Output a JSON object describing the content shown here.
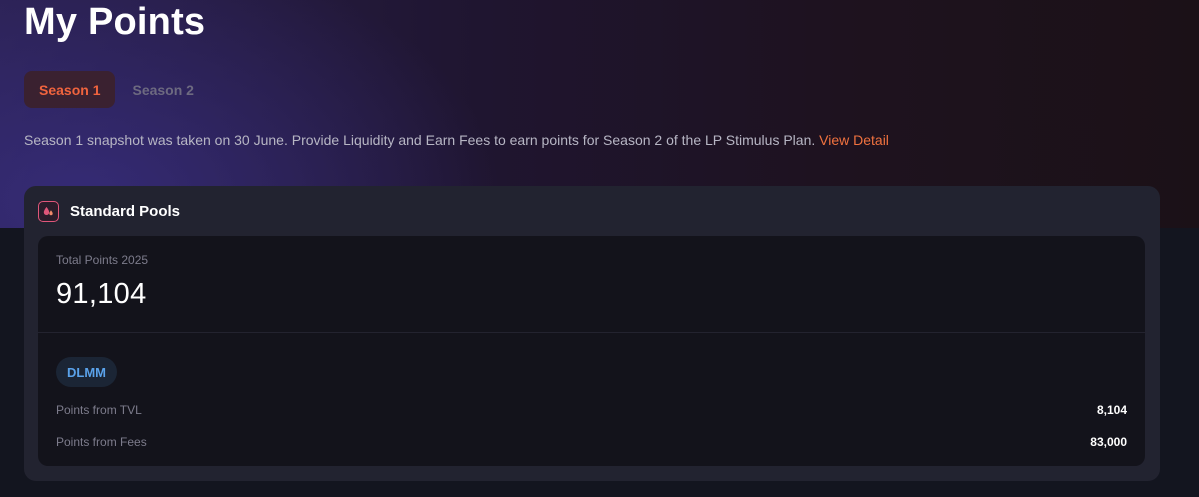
{
  "page": {
    "title": "My Points"
  },
  "tabs": [
    {
      "label": "Season 1",
      "active": true
    },
    {
      "label": "Season 2",
      "active": false
    }
  ],
  "notice": {
    "text": "Season 1 snapshot was taken on 30 June. Provide Liquidity and Earn Fees to earn points for Season 2 of the LP Stimulus Plan.",
    "link_label": "View Detail"
  },
  "card": {
    "icon": "pool-drops-icon",
    "title": "Standard Pools",
    "total_label": "Total Points 2025",
    "total_value": "91,104",
    "badge": "DLMM",
    "rows": [
      {
        "label": "Points from TVL",
        "value": "8,104"
      },
      {
        "label": "Points from Fees",
        "value": "83,000"
      }
    ]
  },
  "colors": {
    "accent": "#f0643e",
    "link": "#f0723f",
    "badge_text": "#5aa2ea",
    "icon_accent": "#e0567a"
  }
}
